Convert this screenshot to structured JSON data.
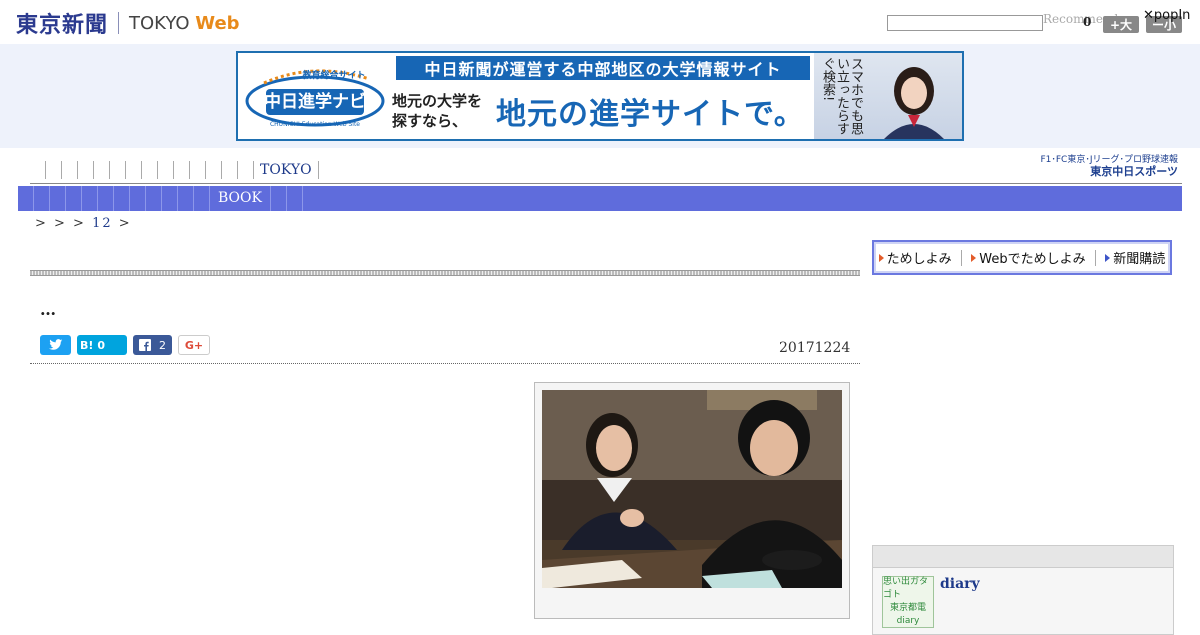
{
  "header": {
    "logo_jp": "東京新聞",
    "logo_en": "TOKYO",
    "logo_web": "Web",
    "recommend_label": "Recommend",
    "recommend_count": "0",
    "font_larger": "+大",
    "font_smaller": "ー小",
    "popin": "✕popIn"
  },
  "banner": {
    "logo_text": "中日進学ナビ",
    "logo_top": "教育総合サイト",
    "logo_sub": "CHUNICHI Education Web Site",
    "headline": "中日新聞が運営する中部地区の大学情報サイト",
    "sub_line1": "地元の大学を",
    "sub_line2": "探すなら、",
    "main": "地元の進学サイトで。",
    "vertical": "スマホでも思い立ったらすぐ検索!"
  },
  "nav": {
    "top_item": "TOKYO",
    "sub_item": "BOOK",
    "sports_line1": "F1･FC東京･Jリーグ･プロ野球速報",
    "sports_line2": "東京中日スポーツ"
  },
  "breadcrumb": {
    "seps": "> > >",
    "num": "12",
    "tail": ">"
  },
  "article": {
    "headline": "…",
    "date": "20171224",
    "hatena_label": "B!",
    "hatena_count": "0",
    "facebook_count": "2",
    "gplus_label": "G+"
  },
  "promo": {
    "item1": "ためしよみ",
    "item2": "Webでためしよみ",
    "item3": "新聞購読"
  },
  "sidebar": {
    "diary_thumb_line1": "思い出ガタゴト",
    "diary_thumb_line2": "東京都電",
    "diary_thumb_line3": "diary",
    "diary_title": "diary"
  }
}
